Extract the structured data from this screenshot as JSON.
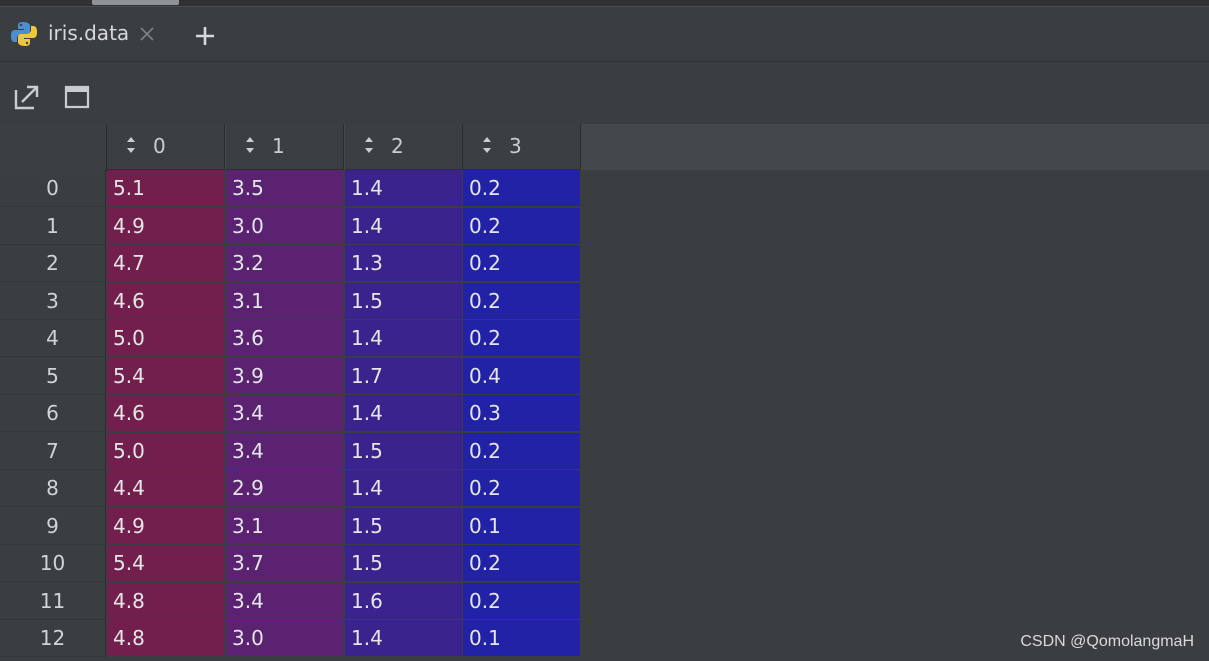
{
  "tab": {
    "label": "iris.data"
  },
  "colors": {
    "col0": "#731f4d",
    "col1": "#5a2270",
    "col2": "#3a238c",
    "col3": "#2222a6"
  },
  "table": {
    "columns": [
      "0",
      "1",
      "2",
      "3"
    ],
    "rows": [
      {
        "index": "0",
        "values": [
          "5.1",
          "3.5",
          "1.4",
          "0.2"
        ]
      },
      {
        "index": "1",
        "values": [
          "4.9",
          "3.0",
          "1.4",
          "0.2"
        ]
      },
      {
        "index": "2",
        "values": [
          "4.7",
          "3.2",
          "1.3",
          "0.2"
        ]
      },
      {
        "index": "3",
        "values": [
          "4.6",
          "3.1",
          "1.5",
          "0.2"
        ]
      },
      {
        "index": "4",
        "values": [
          "5.0",
          "3.6",
          "1.4",
          "0.2"
        ]
      },
      {
        "index": "5",
        "values": [
          "5.4",
          "3.9",
          "1.7",
          "0.4"
        ]
      },
      {
        "index": "6",
        "values": [
          "4.6",
          "3.4",
          "1.4",
          "0.3"
        ]
      },
      {
        "index": "7",
        "values": [
          "5.0",
          "3.4",
          "1.5",
          "0.2"
        ]
      },
      {
        "index": "8",
        "values": [
          "4.4",
          "2.9",
          "1.4",
          "0.2"
        ]
      },
      {
        "index": "9",
        "values": [
          "4.9",
          "3.1",
          "1.5",
          "0.1"
        ]
      },
      {
        "index": "10",
        "values": [
          "5.4",
          "3.7",
          "1.5",
          "0.2"
        ]
      },
      {
        "index": "11",
        "values": [
          "4.8",
          "3.4",
          "1.6",
          "0.2"
        ]
      },
      {
        "index": "12",
        "values": [
          "4.8",
          "3.0",
          "1.4",
          "0.1"
        ]
      }
    ]
  },
  "watermark": "CSDN @QomolangmaH"
}
